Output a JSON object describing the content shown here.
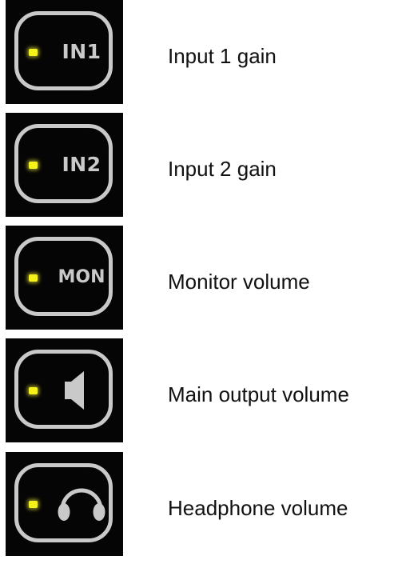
{
  "controls": [
    {
      "tile_text": "IN1",
      "label": "Input 1 gain",
      "icon": "text"
    },
    {
      "tile_text": "IN2",
      "label": "Input 2 gain",
      "icon": "text"
    },
    {
      "tile_text": "MON",
      "label": "Monitor volume",
      "icon": "text"
    },
    {
      "tile_text": "",
      "label": "Main output volume",
      "icon": "speaker-icon"
    },
    {
      "tile_text": "",
      "label": "Headphone volume",
      "icon": "headphones-icon"
    }
  ],
  "colors": {
    "tile_background": "#050505",
    "frame": "#c9c9c9",
    "led": "#f4f21a",
    "label_text": "#111111"
  }
}
